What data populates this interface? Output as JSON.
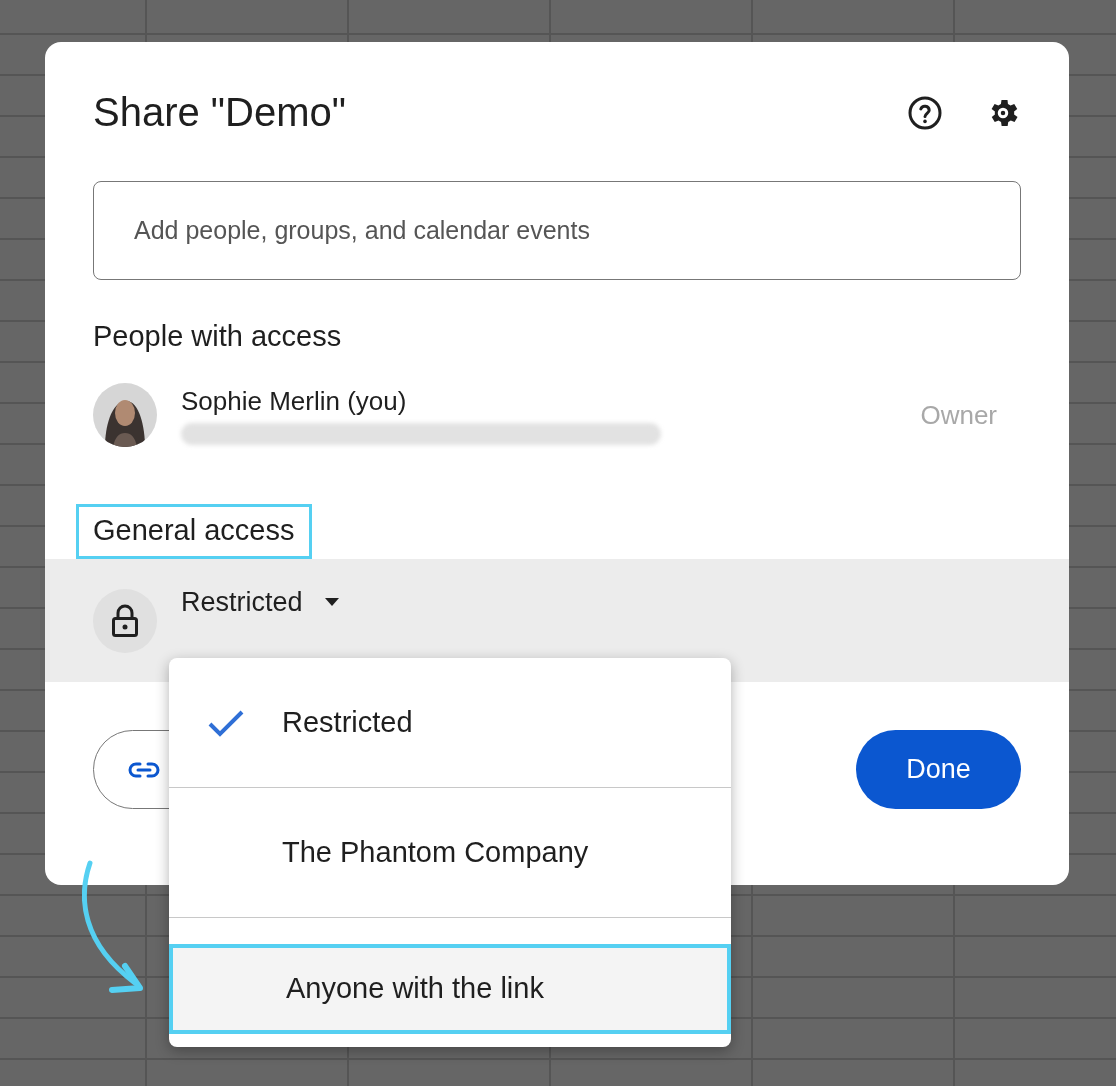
{
  "dialog": {
    "title": "Share \"Demo\"",
    "search": {
      "placeholder": "Add people, groups, and calendar events"
    },
    "people_heading": "People with access",
    "people": [
      {
        "name": "Sophie Merlin (you)",
        "role": "Owner"
      }
    ],
    "general_access": {
      "heading": "General access",
      "highlighted": true,
      "value": "Restricted"
    },
    "done_button": "Done"
  },
  "access_menu": {
    "items": [
      {
        "label": "Restricted",
        "selected": true,
        "highlighted": false
      },
      {
        "label": "The Phantom Company",
        "selected": false,
        "highlighted": false
      },
      {
        "label": "Anyone with the link",
        "selected": false,
        "highlighted": true
      }
    ]
  }
}
